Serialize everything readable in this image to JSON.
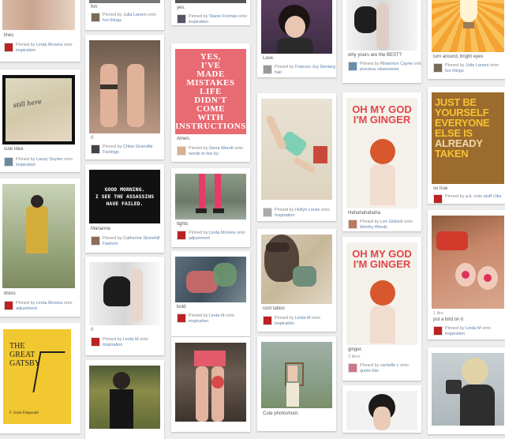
{
  "pins": [
    {
      "caption": "lines",
      "pinner": "Linda Mcnera",
      "board": "inspiration"
    },
    {
      "caption": "cute idea",
      "pinner": "Lacey Snyder",
      "board": "inspiration"
    },
    {
      "caption": "dress",
      "pinner": "Linda Mcnera",
      "board": "adjustment"
    },
    {
      "caption": "",
      "pinner": "",
      "board": ""
    },
    {
      "caption": "hm",
      "pinner": "Julia Larsen",
      "board": "fun things"
    },
    {
      "caption": "//",
      "pinner": "Chloe Granville",
      "board": "Feelings"
    },
    {
      "caption": "Marianne",
      "pinner": "Catherine Stonehill",
      "board": "Fashion"
    },
    {
      "caption": "//",
      "pinner": "Linda M",
      "board": "Inspiration"
    },
    {
      "caption": "yes.",
      "pinner": "Stacie Forman",
      "board": "inspiration"
    },
    {
      "caption": "Amen.",
      "pinner": "Gena Wendt",
      "board": "words to live by"
    },
    {
      "caption": "tights",
      "pinner": "Linda Mcnera",
      "board": "adjustment"
    },
    {
      "caption": "bold",
      "pinner": "Linda M",
      "board": "inspiration"
    },
    {
      "caption": "Love.",
      "pinner": "Frances Joy Dentarg",
      "board": "hair"
    },
    {
      "caption": "",
      "pinner": "Hollyn Locke",
      "board": "Inspiration"
    },
    {
      "caption": "cool tattoo",
      "pinner": "Linda M",
      "board": "inspiration"
    },
    {
      "caption": "Cute photoshoot.",
      "pinner": "",
      "board": ""
    },
    {
      "caption": "why yours are the BEST?",
      "pinner": "Rhiannon Cayne",
      "board": "precious obsessives"
    },
    {
      "caption": "Hahahahahaha",
      "pinner": "Lee Gidsick",
      "board": "Worthy Words"
    },
    {
      "caption": "ginger.",
      "pinner": "rachelle c",
      "board": "quote this"
    },
    {
      "caption": "",
      "pinner": "",
      "board": ""
    },
    {
      "caption": "turn around, bright eyes",
      "pinner": "Julie Larsen",
      "board": "fun things"
    },
    {
      "caption": "so true",
      "pinner": "a.k.",
      "board": "stuff i like"
    },
    {
      "caption": "put a bird on it",
      "pinner": "Linda M",
      "board": "inspiration"
    },
    {
      "caption": "",
      "pinner": "",
      "board": ""
    }
  ],
  "labels": {
    "pinned_by": "Pinned by",
    "onto": "onto",
    "likes_1": "1 like",
    "likes_3": "3 likes",
    "repins_1": "1 repin"
  },
  "posters": {
    "yes_mistakes": [
      "YES,",
      "I'VE",
      "MADE",
      "MISTAKES",
      "LIFE",
      "DIDN'T",
      "COME",
      "WITH",
      "INSTRUCTIONS"
    ],
    "good_morning": [
      "GOOD MORNING.",
      "I SEE THE ASSASSINS",
      "HAVE FAILED."
    ],
    "ginger": [
      "OH MY GOD",
      "I'M GINGER"
    ],
    "be_yourself": [
      "JUST BE",
      "YOURSELF",
      "EVERYONE",
      "ELSE IS",
      "ALREADY",
      "TAKEN"
    ],
    "gatsby": {
      "title_1": "THE",
      "title_2": "GREAT",
      "title_3": "GATSBY",
      "author": "F. Scott Fitzgerald"
    }
  },
  "colors": {
    "pin_bg": "#ffffff",
    "page_bg": "#ededed",
    "link": "#5b7fa6",
    "poster_pink": "#e86a72",
    "ginger_red": "#e0454a"
  }
}
